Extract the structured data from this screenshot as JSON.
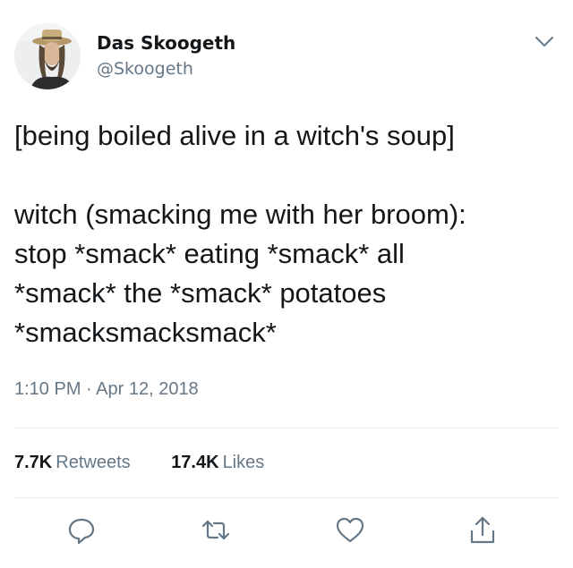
{
  "user": {
    "display_name": "Das Skoogeth",
    "handle": "@Skoogeth"
  },
  "tweet": {
    "lines": [
      "[being boiled alive in a witch's soup]",
      "",
      "witch (smacking me with her broom):",
      "stop *smack* eating *smack* all",
      "*smack* the *smack* potatoes",
      "*smacksmacksmack*"
    ],
    "timestamp": "1:10 PM · Apr 12, 2018"
  },
  "stats": {
    "retweets_count": "7.7K",
    "retweets_label": "Retweets",
    "likes_count": "17.4K",
    "likes_label": "Likes"
  },
  "icons": {
    "menu": "chevron-down-icon",
    "reply": "reply-icon",
    "retweet": "retweet-icon",
    "like": "heart-icon",
    "share": "share-icon"
  },
  "colors": {
    "text": "#14171a",
    "secondary": "#657786",
    "divider": "#e6ecf0"
  }
}
